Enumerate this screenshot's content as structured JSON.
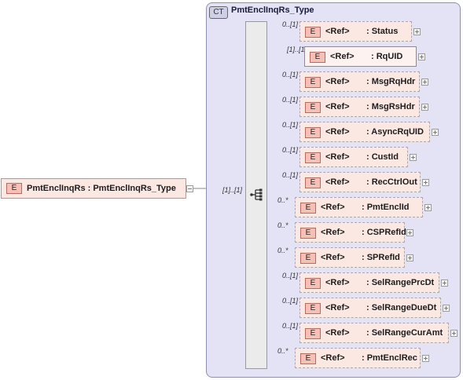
{
  "complex_type": {
    "tag": "CT",
    "name": "PmtEnclInqRs_Type"
  },
  "root": {
    "badge": "E",
    "label": "PmtEnclInqRs : PmtEnclInqRs_Type"
  },
  "connector_occurrence": "[1]..[1]",
  "children": [
    {
      "occ": "0..[1]",
      "badge": "E",
      "ref": "<Ref>",
      "name": ": Status",
      "required": false
    },
    {
      "occ": "[1]..[1]",
      "badge": "E",
      "ref": "<Ref>",
      "name": ": RqUID",
      "required": true
    },
    {
      "occ": "0..[1]",
      "badge": "E",
      "ref": "<Ref>",
      "name": ": MsgRqHdr",
      "required": false
    },
    {
      "occ": "0..[1]",
      "badge": "E",
      "ref": "<Ref>",
      "name": ": MsgRsHdr",
      "required": false
    },
    {
      "occ": "0..[1]",
      "badge": "E",
      "ref": "<Ref>",
      "name": ": AsyncRqUID",
      "required": false
    },
    {
      "occ": "0..[1]",
      "badge": "E",
      "ref": "<Ref>",
      "name": ": CustId",
      "required": false
    },
    {
      "occ": "0..[1]",
      "badge": "E",
      "ref": "<Ref>",
      "name": ": RecCtrlOut",
      "required": false
    },
    {
      "occ": "0..*",
      "badge": "E",
      "ref": "<Ref>",
      "name": ": PmtEnclId",
      "required": false
    },
    {
      "occ": "0..*",
      "badge": "E",
      "ref": "<Ref>",
      "name": ": CSPRefId",
      "required": false
    },
    {
      "occ": "0..*",
      "badge": "E",
      "ref": "<Ref>",
      "name": ": SPRefId",
      "required": false
    },
    {
      "occ": "0..[1]",
      "badge": "E",
      "ref": "<Ref>",
      "name": ": SelRangePrcDt",
      "required": false
    },
    {
      "occ": "0..[1]",
      "badge": "E",
      "ref": "<Ref>",
      "name": ": SelRangeDueDt",
      "required": false
    },
    {
      "occ": "0..[1]",
      "badge": "E",
      "ref": "<Ref>",
      "name": ": SelRangeCurAmt",
      "required": false
    },
    {
      "occ": "0..*",
      "badge": "E",
      "ref": "<Ref>",
      "name": ": PmtEnclRec",
      "required": false
    }
  ]
}
